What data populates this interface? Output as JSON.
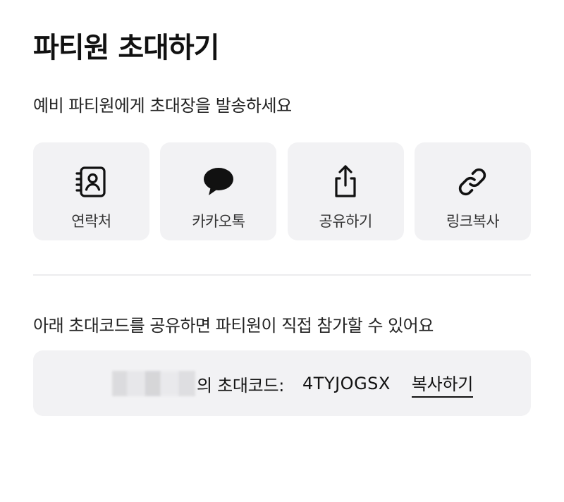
{
  "header": {
    "title": "파티원 초대하기"
  },
  "invite": {
    "subtitle": "예비 파티원에게 초대장을 발송하세요",
    "options": [
      {
        "id": "contacts",
        "label": "연락처",
        "icon": "contacts-icon"
      },
      {
        "id": "kakaotalk",
        "label": "카카오톡",
        "icon": "chat-bubble-icon"
      },
      {
        "id": "share",
        "label": "공유하기",
        "icon": "share-icon"
      },
      {
        "id": "copy-link",
        "label": "링크복사",
        "icon": "link-icon"
      }
    ]
  },
  "code_section": {
    "description": "아래 초대코드를 공유하면 파티원이 직접 참가할 수 있어요",
    "label": "의 초대코드:",
    "code": "4TYJOGSX",
    "copy_label": "복사하기"
  }
}
